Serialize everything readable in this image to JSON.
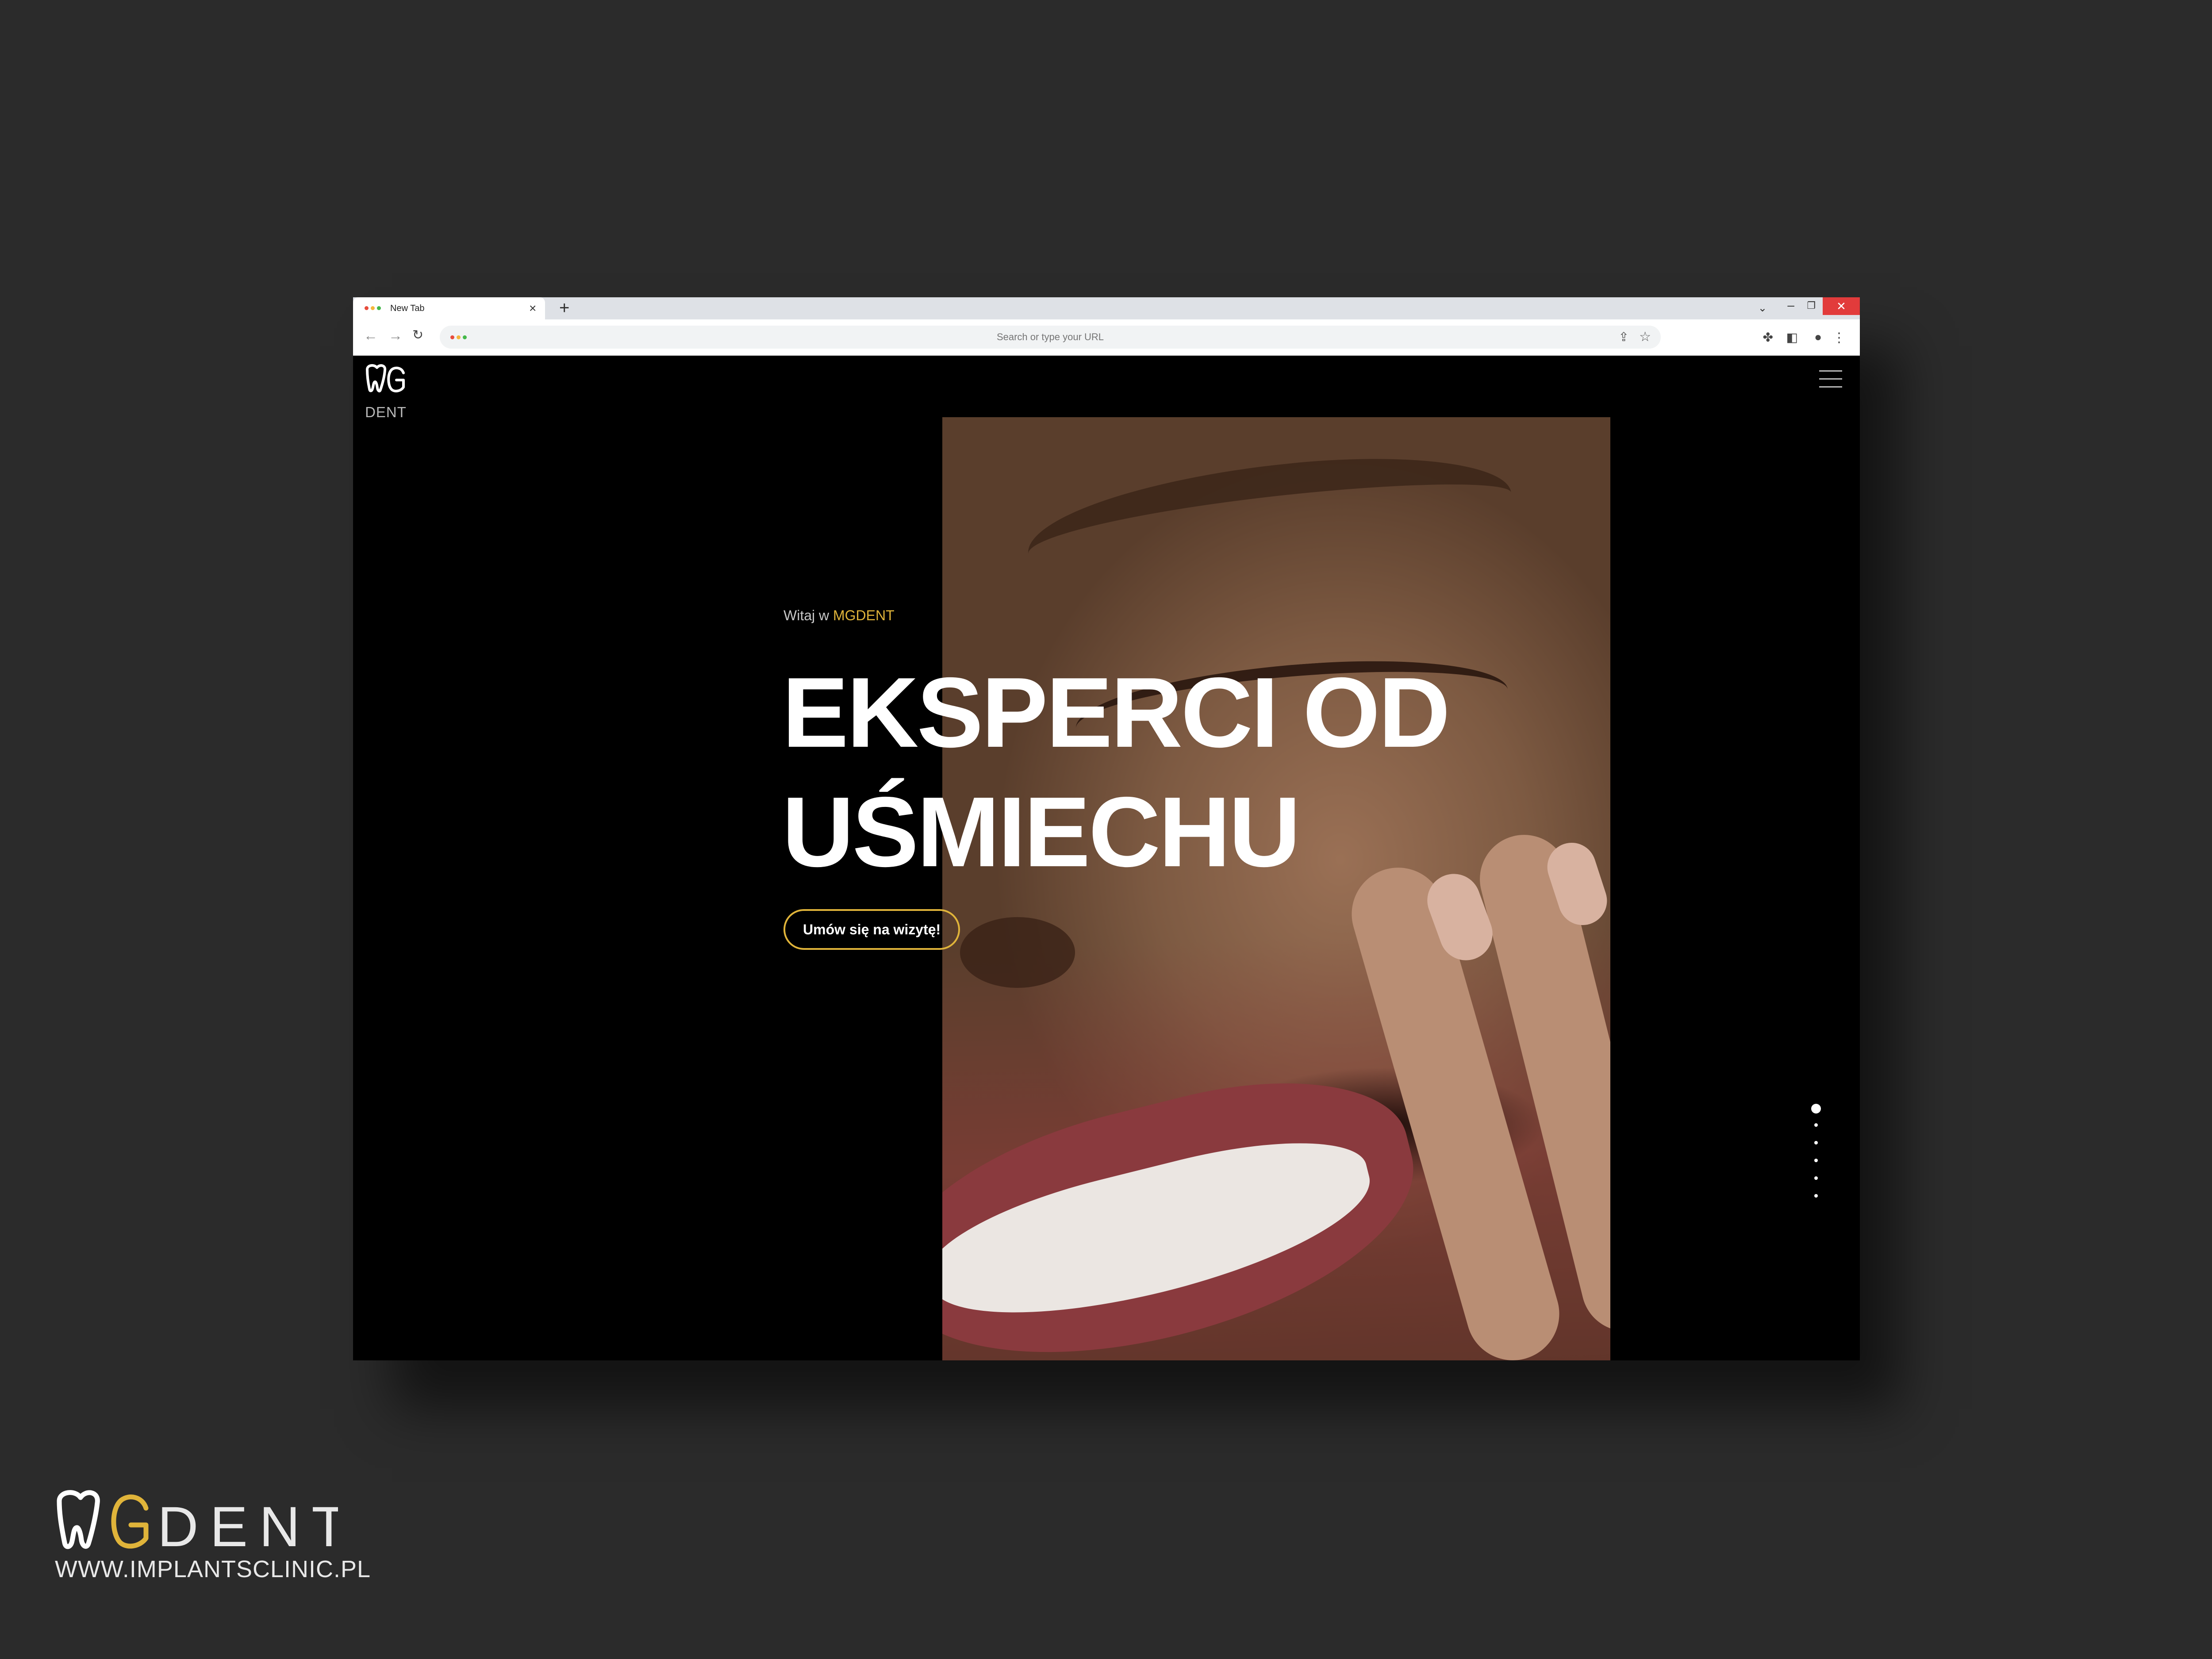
{
  "browser": {
    "tab_title": "New Tab",
    "address_placeholder": "Search or type your URL",
    "traffic_dots": [
      "#e74c3c",
      "#f5b63c",
      "#44b84a"
    ]
  },
  "site": {
    "logo_text": "DENT",
    "hero": {
      "eyebrow_prefix": "Witaj w",
      "eyebrow_brand": "MGDENT",
      "title_line1": "EKSPERCI OD",
      "title_line2": "UŚMIECHU",
      "cta_label": "Umów się na wizytę!"
    },
    "slider": {
      "total": 6,
      "active_index": 0
    }
  },
  "branding": {
    "corner_logo_text": "DENT",
    "corner_url": "WWW.IMPLANTSCLINIC.PL"
  },
  "colors": {
    "page_bg": "#2b2b2b",
    "accent": "#e0b43a",
    "site_bg": "#000000",
    "close_button": "#e23b3b"
  },
  "icons": [
    "tab-close-icon",
    "new-tab-icon",
    "chevron-down-icon",
    "minimize-icon",
    "restore-icon",
    "close-icon",
    "back-arrow-icon",
    "forward-arrow-icon",
    "reload-icon",
    "share-icon",
    "star-icon",
    "puzzle-icon",
    "sidebar-icon",
    "profile-icon",
    "kebab-menu-icon",
    "hamburger-icon"
  ]
}
